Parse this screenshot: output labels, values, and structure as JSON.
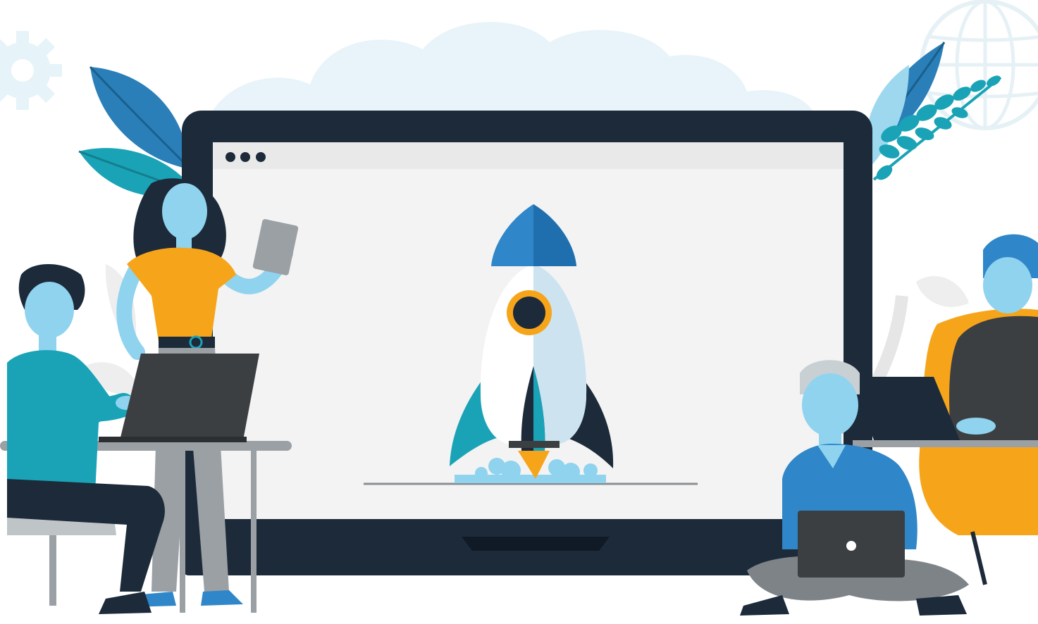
{
  "colors": {
    "navy": "#1c2a3a",
    "screen": "#f3f3f3",
    "browser_bar": "#e9e9e9",
    "blue": "#2f86c8",
    "sky": "#b7e3f6",
    "teal": "#1aa3b6",
    "orange": "#f6a51b",
    "gray": "#7d8387",
    "dark_gray": "#3c3f42",
    "cloud": "#e8f4fa"
  },
  "icons": [
    "gear-icon",
    "globe-icon",
    "window-dots-icon",
    "rocket-icon"
  ],
  "people": [
    "seated-man-at-desk",
    "standing-woman-with-tablet",
    "boy-cross-legged-with-laptop",
    "woman-in-armchair"
  ]
}
